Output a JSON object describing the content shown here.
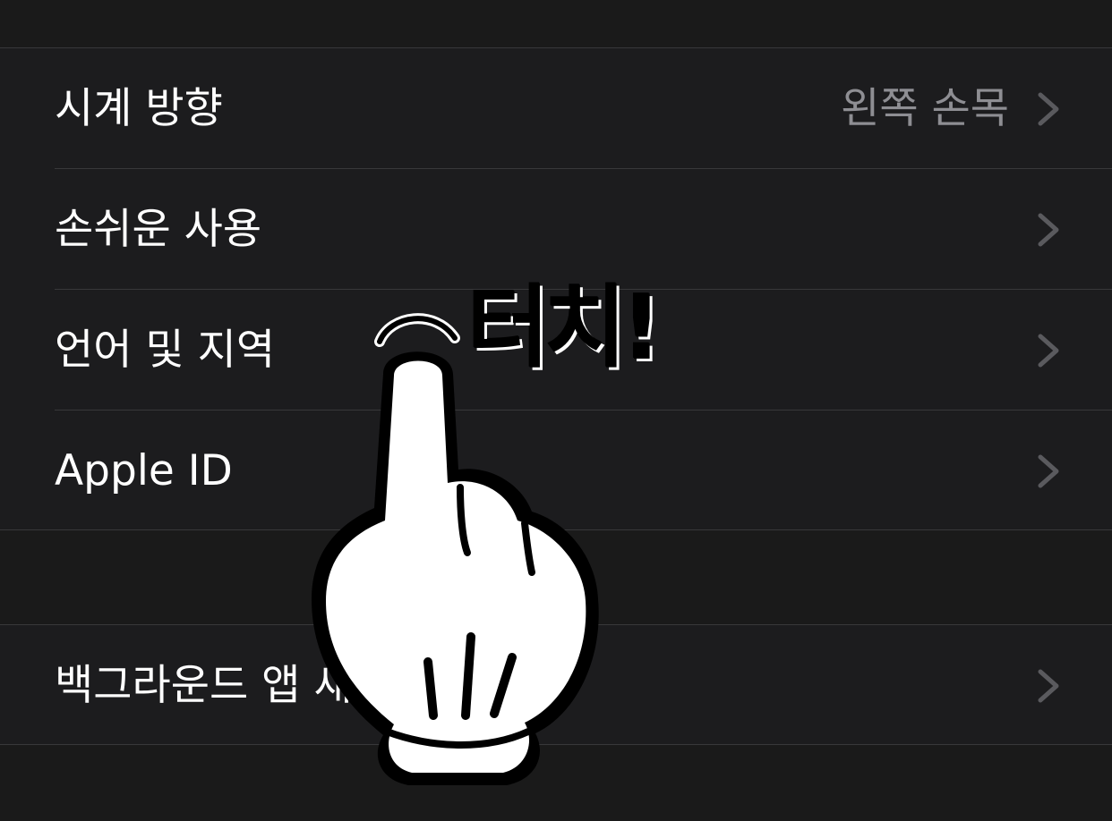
{
  "settings": {
    "rows": [
      {
        "label": "시계 방향",
        "value": "왼쪽 손목"
      },
      {
        "label": "손쉬운 사용",
        "value": ""
      },
      {
        "label": "언어 및 지역",
        "value": ""
      },
      {
        "label": "Apple ID",
        "value": ""
      }
    ],
    "rows2": [
      {
        "label": "백그라운드 앱 새"
      }
    ]
  },
  "overlay": {
    "touch_text": "터치!",
    "icon": "pointing-hand-icon"
  },
  "colors": {
    "background": "#1c1c1e",
    "label": "#ffffff",
    "secondary": "#8e8e93",
    "separator": "#38383a",
    "chevron": "#5a5a5e"
  }
}
